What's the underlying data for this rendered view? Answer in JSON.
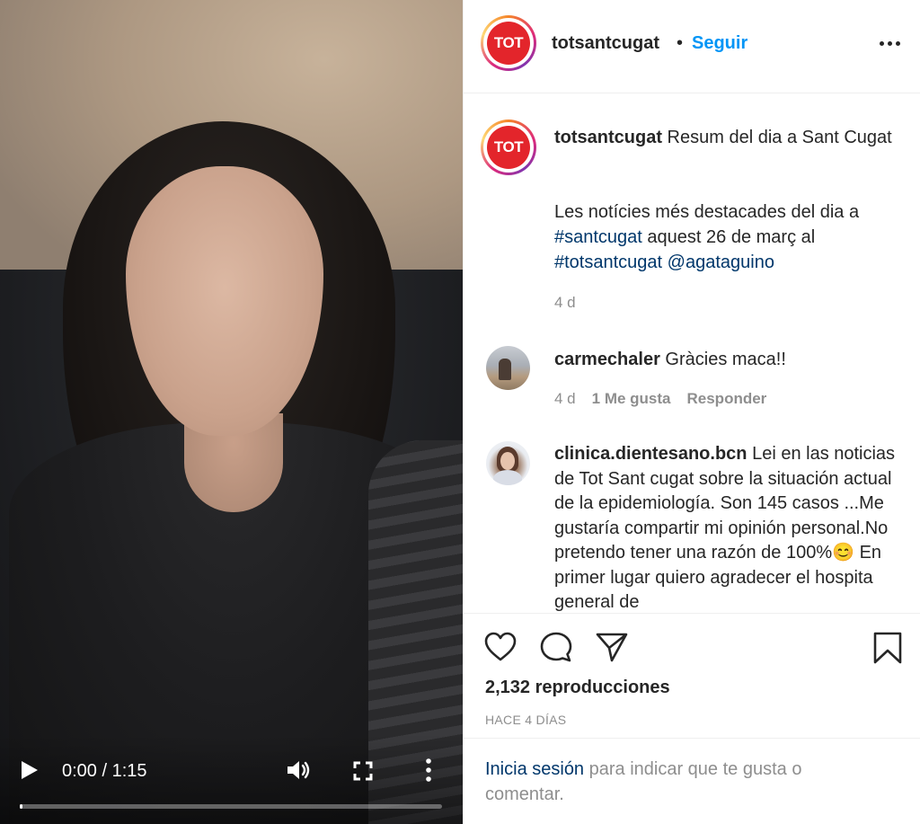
{
  "video": {
    "time_label": "0:00 / 1:15",
    "progress_fraction": 0.0
  },
  "header": {
    "avatar_text": "TOT",
    "username": "totsantcugat",
    "separator": "•",
    "follow_label": "Seguir"
  },
  "caption": {
    "avatar_text": "TOT",
    "username": "totsantcugat",
    "title": " Resum del dia a Sant Cugat",
    "body_prefix": "Les notícies més destacades del dia a ",
    "tag1": "#santcugat",
    "body_middle": " aquest 26 de març al ",
    "tag2": "#totsantcugat",
    "tag3": "@agataguino",
    "age": "4 d"
  },
  "comments": [
    {
      "username": "carmechaler",
      "text": " Gràcies maca!!",
      "age": "4 d",
      "likes": "1 Me gusta",
      "reply": "Responder"
    },
    {
      "username": "clinica.dientesano.bcn",
      "text": " Lei en las noticias de Tot Sant cugat sobre la situación actual de la epidemiología. Son 145 casos ...Me gustaría compartir mi opinión personal.No pretendo tener una razón de 100%😊 En primer lugar quiero agradecer el hospita general de"
    }
  ],
  "actions": {
    "views": "2,132 reproducciones",
    "time_ago": "HACE 4 DÍAS"
  },
  "login": {
    "link": "Inicia sesión",
    "rest": " para indicar que te gusta o comentar."
  },
  "icons": {
    "play": "play-icon",
    "volume": "volume-icon",
    "fullscreen": "fullscreen-icon",
    "more": "more-vertical-icon",
    "header_more": "more-horizontal-icon",
    "like": "heart-icon",
    "comment": "comment-icon",
    "share": "share-icon",
    "save": "bookmark-icon"
  },
  "colors": {
    "brand_red": "#e3252b",
    "link_blue": "#0095f6",
    "tag_blue": "#00376b",
    "muted": "#8e8e8e"
  }
}
